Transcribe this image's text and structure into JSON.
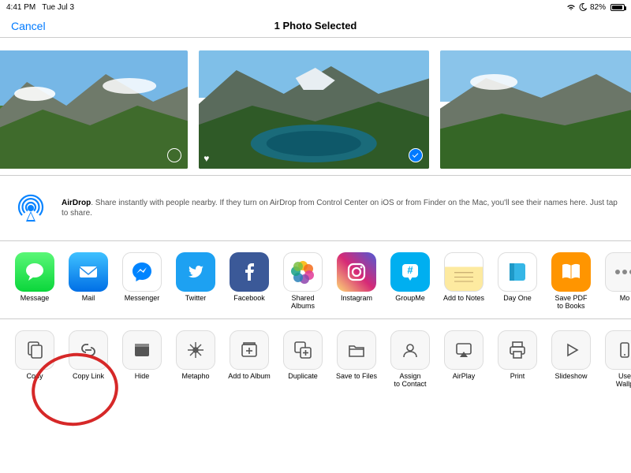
{
  "status": {
    "time": "4:41 PM",
    "date": "Tue Jul 3",
    "battery": "82%"
  },
  "header": {
    "cancel": "Cancel",
    "title": "1 Photo Selected"
  },
  "airdrop": {
    "bold": "AirDrop",
    "rest": ". Share instantly with people nearby. If they turn on AirDrop from Control Center on iOS or from Finder on the Mac, you'll see their names here. Just tap to share."
  },
  "apps": [
    {
      "label": "Message"
    },
    {
      "label": "Mail"
    },
    {
      "label": "Messenger"
    },
    {
      "label": "Twitter"
    },
    {
      "label": "Facebook"
    },
    {
      "label": "Shared Albums"
    },
    {
      "label": "Instagram"
    },
    {
      "label": "GroupMe"
    },
    {
      "label": "Add to Notes"
    },
    {
      "label": "Day One"
    },
    {
      "label": "Save PDF\nto Books"
    },
    {
      "label": "Mo"
    }
  ],
  "actions": [
    {
      "label": "Copy"
    },
    {
      "label": "Copy Link"
    },
    {
      "label": "Hide"
    },
    {
      "label": "Metapho"
    },
    {
      "label": "Add to Album"
    },
    {
      "label": "Duplicate"
    },
    {
      "label": "Save to Files"
    },
    {
      "label": "Assign\nto Contact"
    },
    {
      "label": "AirPlay"
    },
    {
      "label": "Print"
    },
    {
      "label": "Slideshow"
    },
    {
      "label": "Use\nWallp"
    }
  ]
}
